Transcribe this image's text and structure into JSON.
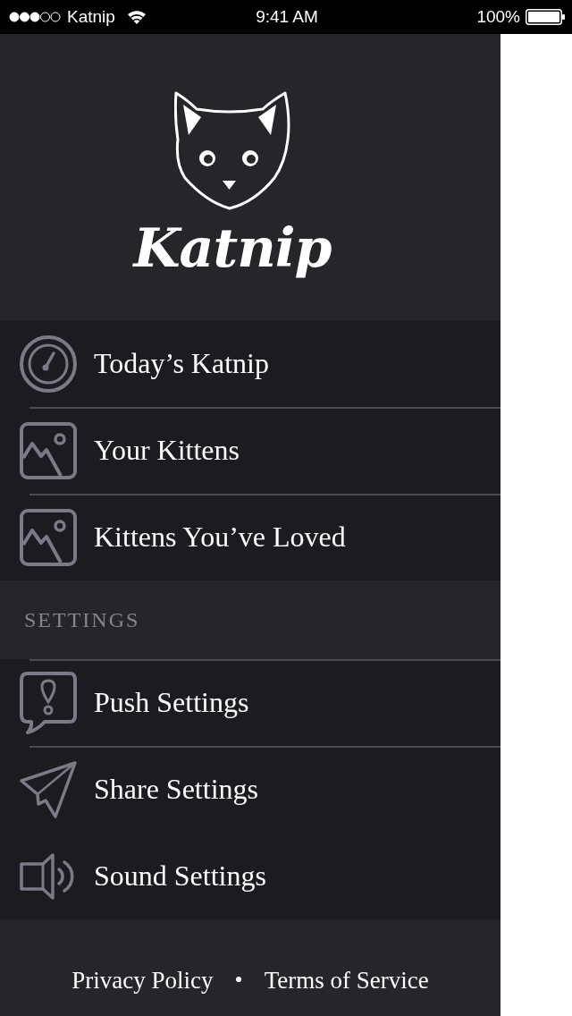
{
  "status_bar": {
    "carrier": "Katnip",
    "time": "9:41 AM",
    "battery": "100%"
  },
  "drawer": {
    "logo_text": "Katnip",
    "menu": [
      {
        "kind": "dial",
        "label": "Today’s Katnip",
        "divider_above": false
      },
      {
        "kind": "photo",
        "label": "Your Kittens",
        "divider_above": true
      },
      {
        "kind": "photo",
        "label": "Kittens You’ve Loved",
        "divider_above": true
      }
    ],
    "settings": {
      "heading": "SETTINGS",
      "items": [
        {
          "kind": "alert",
          "label": "Push Settings",
          "divider_above": true
        },
        {
          "kind": "send",
          "label": "Share Settings",
          "divider_above": true
        },
        {
          "kind": "sound",
          "label": "Sound Settings",
          "divider_above": false
        }
      ]
    },
    "footer": {
      "links": [
        "Privacy Policy",
        "Terms of Service"
      ],
      "separator": "•"
    }
  }
}
